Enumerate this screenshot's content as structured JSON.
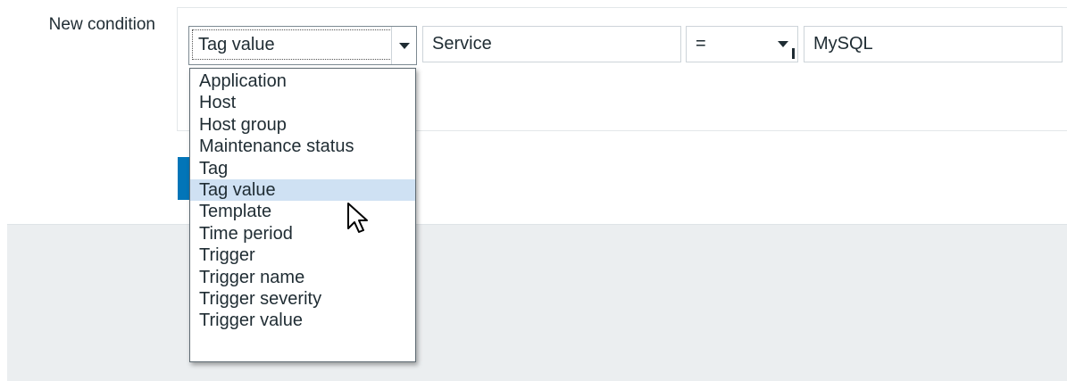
{
  "form": {
    "label": "New condition"
  },
  "condition": {
    "type_selected": "Tag value",
    "tag_input_value": "Service",
    "operator_selected": "=",
    "value_input_value": "MySQL"
  },
  "dropdown": {
    "items": [
      "Application",
      "Host",
      "Host group",
      "Maintenance status",
      "Tag",
      "Tag value",
      "Template",
      "Time period",
      "Trigger",
      "Trigger name",
      "Trigger severity",
      "Trigger value"
    ],
    "highlighted": "Tag value"
  },
  "colors": {
    "primary_button": "#0275b8",
    "highlight": "#cfe1f3"
  }
}
